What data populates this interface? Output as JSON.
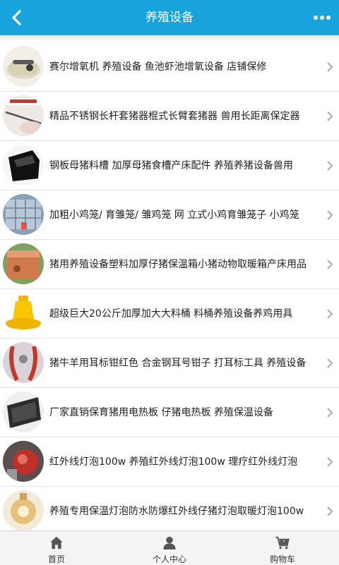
{
  "header": {
    "title": "养殖设备",
    "back_icon": "chevron-left-icon",
    "more_icon": "more-dots-icon",
    "color": "#18a3dc"
  },
  "products": [
    {
      "name": "赛尔增氧机 养殖设备 鱼池虾池增氧设备 店铺保修"
    },
    {
      "name": "精品不锈钢长杆套猪器棍式长臂套猪器 兽用长距离保定器"
    },
    {
      "name": "钢板母猪料槽 加厚母猪食槽产床配件 养殖养猪设备兽用"
    },
    {
      "name": "加粗小鸡笼/ 育雏笼/ 雏鸡笼 网 立式小鸡育雏笼子 小鸡笼"
    },
    {
      "name": "猪用养殖设备塑料加厚仔猪保温箱小猪动物取暖箱产床用品"
    },
    {
      "name": "超级巨大20公斤加厚加大大料桶 料桶养殖设备养鸡用具"
    },
    {
      "name": "猪牛羊用耳标钳红色 合金钢耳号钳子 打耳标工具 养殖设备"
    },
    {
      "name": "厂家直销保育猪用电热板 仔猪电热板 养殖保温设备"
    },
    {
      "name": "红外线灯泡100w 养殖红外线灯泡100w 理疗红外线灯泡"
    },
    {
      "name": "养殖专用保温灯泡防水防爆红外线仔猪灯泡取暖灯泡100w"
    }
  ],
  "tabbar": {
    "home": "首页",
    "user": "个人中心",
    "cart": "购物车"
  }
}
